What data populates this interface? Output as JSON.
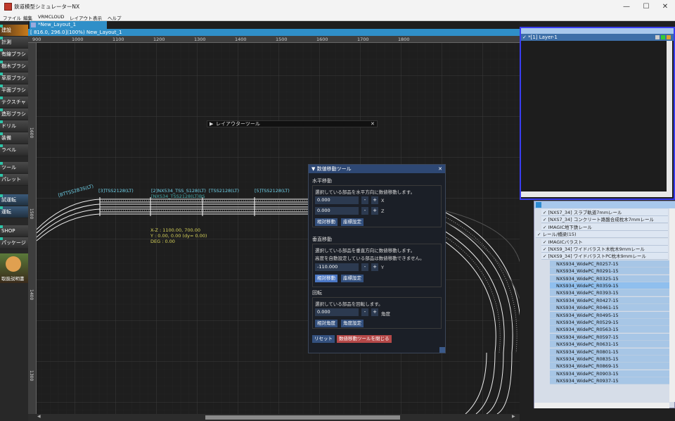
{
  "window": {
    "title": "鉄道模型シミュレーターNX",
    "minimize": "—",
    "maximize": "☐",
    "close": "✕"
  },
  "menu": [
    "ファイル",
    "編集",
    "VRMCLOUD",
    "レイアウト",
    "表示",
    "ヘルプ"
  ],
  "leftbar": {
    "items": [
      "建設",
      "計測",
      "有線ブラシ",
      "樹木ブラシ",
      "草原ブラシ",
      "平面ブラシ",
      "テクスチャ",
      "造形ブラシ",
      "ドリル",
      "装備",
      "ラベル",
      "ツール",
      "パレット",
      "試運転",
      "運転",
      "SHOP",
      "パッケージ",
      "取扱説明書"
    ]
  },
  "document": {
    "tab": "*New_Layout_1",
    "info": "[ 816.0,  296.0](100%) New_Layout_1"
  },
  "ruler_top": [
    "900",
    "1000",
    "1100",
    "1200",
    "1300",
    "1400",
    "1500",
    "1600",
    "1700",
    "1800"
  ],
  "ruler_left": [
    "1600",
    "1500",
    "1400",
    "1300",
    "1200"
  ],
  "canvas": {
    "labels": [
      "[3]TSS2128(LT)",
      "[2]NX534_TSS_S128(LT)",
      "[TSS2128(LT)",
      "[5]TSS2128(LT)",
      "[BTTSS2B3S(LT)",
      "[NXS34_TSS2128(LT)BS"
    ],
    "coords": {
      "xz": "X-Z : 1100.00,   700.00",
      "y": "Y :   0.00,    0.00 (dy=    0.00)",
      "deg": "DEG : 0.00"
    }
  },
  "layouter_tool": {
    "title": "レイアウターツール",
    "close": "✕",
    "arrow": "▶"
  },
  "numeric_tool": {
    "title": "数値移動ツール",
    "close": "✕",
    "horizontal": {
      "heading": "水平移動",
      "desc": "選択している部品を水平方向に数値移動します。",
      "x_value": "0.000",
      "x_label": "X",
      "z_value": "0.000",
      "z_label": "Z",
      "btn_rel": "相対移動",
      "btn_coord": "座標設定"
    },
    "vertical": {
      "heading": "垂直移動",
      "desc": "選択している部品を垂直方向に数値移動します。",
      "note": "高度を自動設定している部品は数値移動できません。",
      "y_value": "-110.000",
      "y_label": "Y",
      "btn_rel": "相対移動",
      "btn_coord": "座標設定"
    },
    "rotation": {
      "heading": "回転",
      "desc": "選択している部品を回転します。",
      "angle_value": "0.000",
      "angle_label": "角度",
      "btn_rel": "相対角度",
      "btn_set": "角度設定"
    },
    "reset": "リセット",
    "close_tool": "数値移動ツールを閉じる",
    "minus": "-",
    "plus": "+"
  },
  "layers_panel": {
    "layer": "*[1] Layer-1"
  },
  "parts_tree": [
    {
      "text": "[NXS7_34] スラブ軌道7mmレール",
      "kind": "cat",
      "indent": 1
    },
    {
      "text": "[NXS7_34] コンクリート路盤合成枕木7mmレール",
      "kind": "cat",
      "indent": 1
    },
    {
      "text": "IMAGIC地下鉄レール",
      "kind": "cat",
      "indent": 1
    },
    {
      "text": "レール/橋梁(15)",
      "kind": "cat",
      "indent": 0
    },
    {
      "text": "IMAGICバラスト",
      "kind": "cat",
      "indent": 1
    },
    {
      "text": "[NXS9_34] ワイドバラスト木枕木9mmレール",
      "kind": "cat",
      "indent": 1
    },
    {
      "text": "[NXS9_34] ワイドバラストPC枕木9mmレール",
      "kind": "cat",
      "indent": 1
    },
    {
      "text": "NXS934_WidePC_R0257-15",
      "kind": "leaf"
    },
    {
      "text": "NXS934_WidePC_R0291-15",
      "kind": "leaf"
    },
    {
      "text": "NXS934_WidePC_R0325-15",
      "kind": "leaf"
    },
    {
      "text": "NXS934_WidePC_R0359-15",
      "kind": "leaf",
      "selected": true
    },
    {
      "text": "NXS934_WidePC_R0393-15",
      "kind": "leaf"
    },
    {
      "text": "NXS934_WidePC_R0427-15",
      "kind": "leaf"
    },
    {
      "text": "NXS934_WidePC_R0461-15",
      "kind": "leaf"
    },
    {
      "text": "NXS934_WidePC_R0495-15",
      "kind": "leaf"
    },
    {
      "text": "NXS934_WidePC_R0529-15",
      "kind": "leaf"
    },
    {
      "text": "NXS934_WidePC_R0563-15",
      "kind": "leaf"
    },
    {
      "text": "NXS934_WidePC_R0597-15",
      "kind": "leaf"
    },
    {
      "text": "NXS934_WidePC_R0631-15",
      "kind": "leaf"
    },
    {
      "text": "NXS934_WidePC_R0801-15",
      "kind": "leaf"
    },
    {
      "text": "NXS934_WidePC_R0835-15",
      "kind": "leaf"
    },
    {
      "text": "NXS934_WidePC_R0869-15",
      "kind": "leaf"
    },
    {
      "text": "NXS934_WidePC_R0903-15",
      "kind": "leaf"
    },
    {
      "text": "NXS934_WidePC_R0937-15",
      "kind": "leaf"
    }
  ]
}
